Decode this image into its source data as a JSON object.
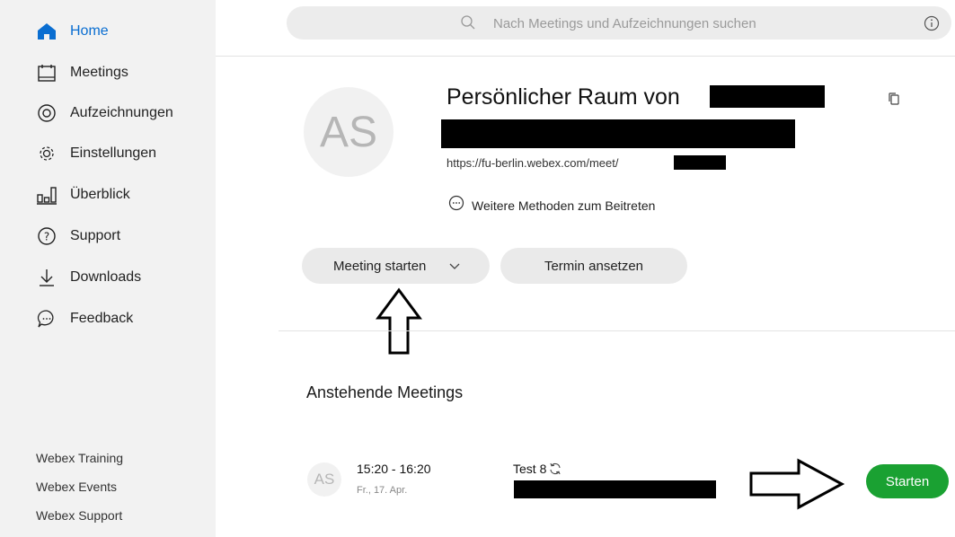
{
  "sidebar": {
    "items": [
      {
        "label": "Home",
        "icon": "home-icon",
        "active": true
      },
      {
        "label": "Meetings",
        "icon": "calendar-icon"
      },
      {
        "label": "Aufzeichnungen",
        "icon": "record-icon"
      },
      {
        "label": "Einstellungen",
        "icon": "gear-icon"
      },
      {
        "label": "Überblick",
        "icon": "analytics-icon"
      },
      {
        "label": "Support",
        "icon": "help-icon"
      },
      {
        "label": "Downloads",
        "icon": "download-icon"
      },
      {
        "label": "Feedback",
        "icon": "chat-icon"
      }
    ],
    "footer_links": [
      "Webex Training",
      "Webex Events",
      "Webex Support"
    ]
  },
  "search": {
    "placeholder": "Nach Meetings und Aufzeichnungen suchen"
  },
  "room": {
    "avatar_initials": "AS",
    "title": "Persönlicher Raum von",
    "url": "https://fu-berlin.webex.com/meet/",
    "more_join_label": "Weitere Methoden zum Beitreten"
  },
  "actions": {
    "start_meeting_label": "Meeting starten",
    "schedule_label": "Termin ansetzen"
  },
  "upcoming": {
    "title": "Anstehende Meetings",
    "meetings": [
      {
        "avatar_initials": "AS",
        "time": "15:20 - 16:20",
        "date": "Fr., 17. Apr.",
        "title": "Test 8",
        "start_label": "Starten"
      }
    ]
  },
  "colors": {
    "accent": "#0a6ed1",
    "start_button": "#1aa132",
    "sidebar_bg": "#f2f2f2"
  }
}
